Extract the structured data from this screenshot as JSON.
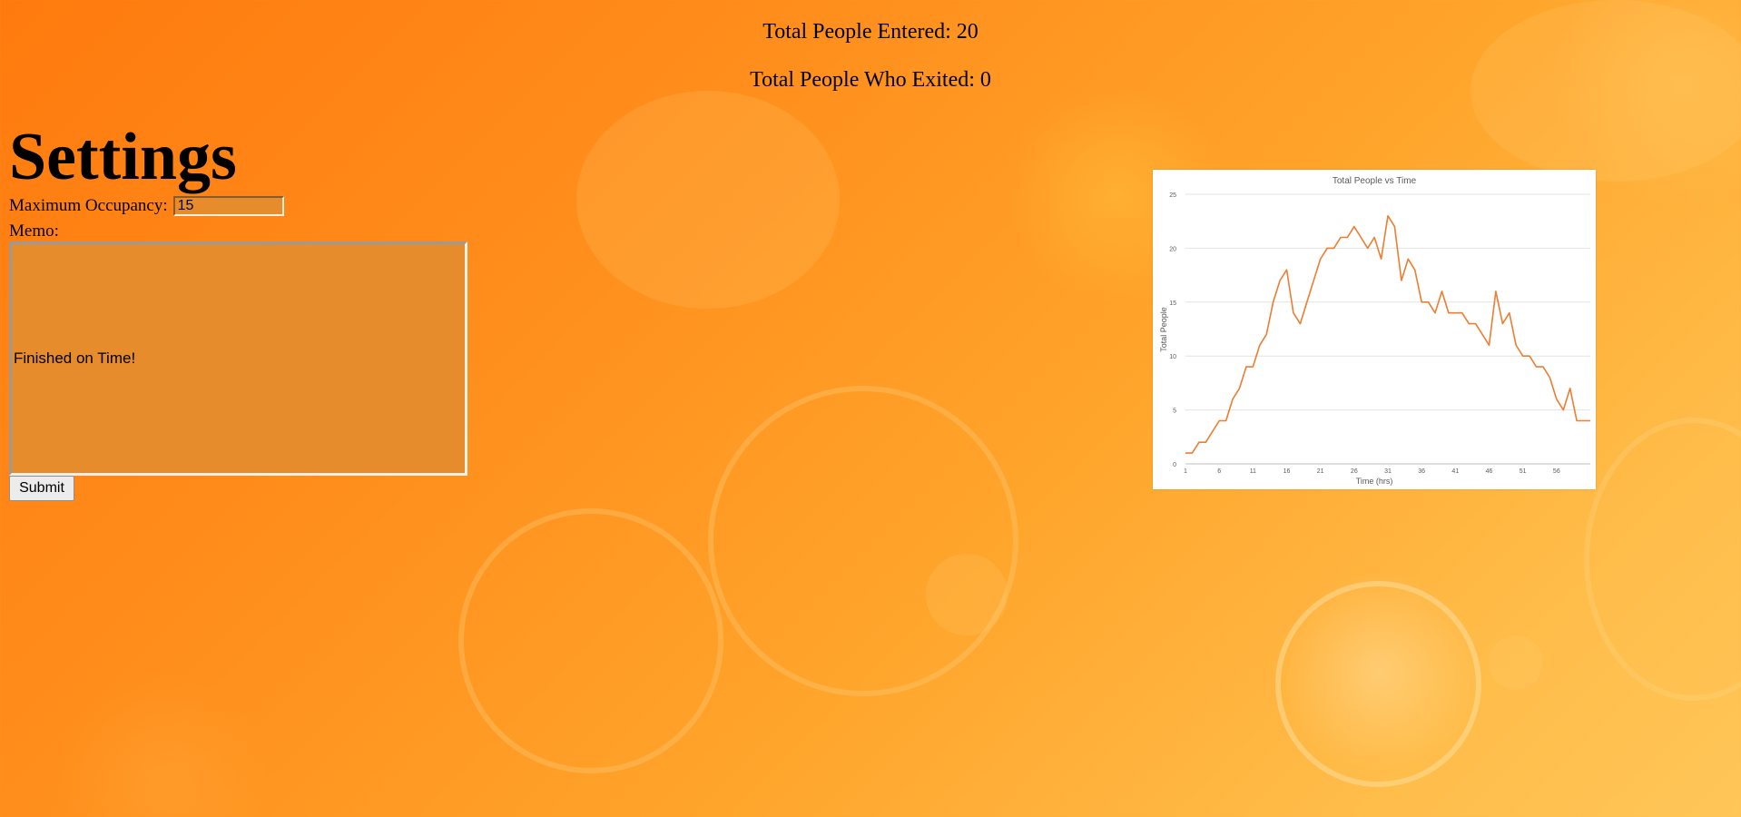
{
  "stats": {
    "entered": "Total People Entered: 20",
    "exited": "Total People Who Exited: 0"
  },
  "settings": {
    "heading": "Settings",
    "max_occupancy_label": "Maximum Occupancy:",
    "max_occupancy_value": "15",
    "memo_label": "Memo:",
    "memo_value": "Finished on Time!",
    "submit_label": "Submit"
  },
  "colors": {
    "background_start": "#ff7a0e",
    "background_end": "#ffc658",
    "field_background": "#e68c2c",
    "series_line": "#ed7d31"
  },
  "chart_data": {
    "type": "line",
    "title": "Total People vs Time",
    "xlabel": "Time (hrs)",
    "ylabel": "Total People",
    "ylim": [
      0,
      25
    ],
    "yticks": [
      0,
      5,
      10,
      15,
      20,
      25
    ],
    "xticks": [
      1,
      6,
      11,
      16,
      21,
      26,
      31,
      36,
      41,
      46,
      51,
      56
    ],
    "xlim": [
      1,
      61
    ],
    "grid": true,
    "legend": "none",
    "series": [
      {
        "x": [
          1,
          2,
          3,
          4,
          5,
          6,
          7,
          8,
          9,
          10,
          11,
          12,
          13,
          14,
          15,
          16,
          17,
          18,
          19,
          20,
          21,
          22,
          23,
          24,
          25,
          26,
          27,
          28,
          29,
          30,
          31,
          32,
          33,
          34,
          35,
          36,
          37,
          38,
          39,
          40,
          41,
          42,
          43,
          44,
          45,
          46,
          47,
          48,
          49,
          50,
          51,
          52,
          53,
          54,
          55,
          56,
          57,
          58,
          59,
          60,
          61
        ],
        "values": [
          1,
          1,
          2,
          2,
          3,
          4,
          4,
          6,
          7,
          9,
          9,
          11,
          12,
          15,
          17,
          18,
          14,
          13,
          15,
          17,
          19,
          20,
          20,
          21,
          21,
          22,
          21,
          20,
          21,
          19,
          23,
          22,
          17,
          19,
          18,
          15,
          15,
          14,
          16,
          14,
          14,
          14,
          13,
          13,
          12,
          11,
          16,
          13,
          14,
          11,
          10,
          10,
          9,
          9,
          8,
          6,
          5,
          7,
          4,
          4,
          4
        ]
      }
    ]
  }
}
